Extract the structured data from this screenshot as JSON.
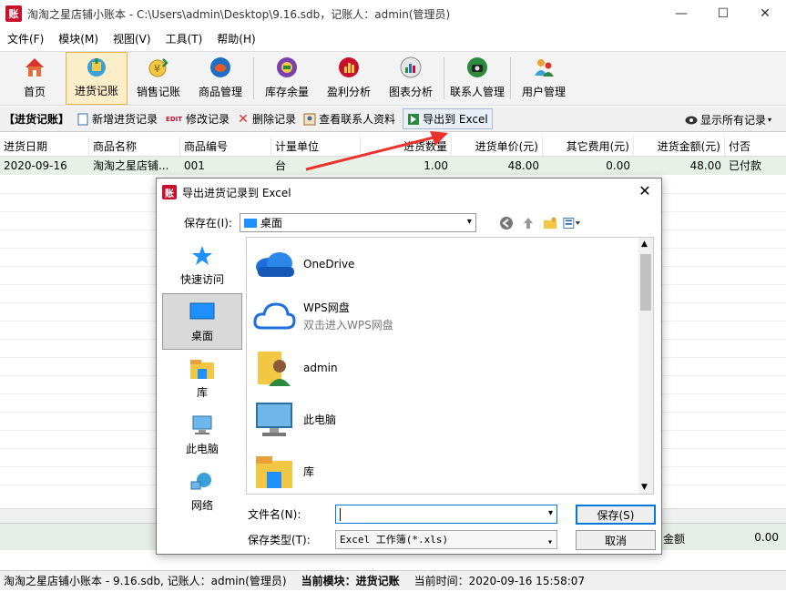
{
  "window": {
    "logo": "账",
    "title": "淘淘之星店铺小账本 - C:\\Users\\admin\\Desktop\\9.16.sdb，记账人：admin(管理员)",
    "minimize": "—",
    "maximize": "☐",
    "close": "✕"
  },
  "menu": [
    "文件(F)",
    "模块(M)",
    "视图(V)",
    "工具(T)",
    "帮助(H)"
  ],
  "toolbar": [
    {
      "label": "首页",
      "icon": "home-icon"
    },
    {
      "label": "进货记账",
      "icon": "purchase-icon",
      "active": true
    },
    {
      "label": "销售记账",
      "icon": "sales-icon"
    },
    {
      "label": "商品管理",
      "icon": "product-icon"
    },
    {
      "label": "库存余量",
      "icon": "inventory-icon"
    },
    {
      "label": "盈利分析",
      "icon": "profit-icon"
    },
    {
      "label": "图表分析",
      "icon": "chart-icon"
    },
    {
      "label": "联系人管理",
      "icon": "contact-icon"
    },
    {
      "label": "用户管理",
      "icon": "user-icon"
    }
  ],
  "subbar": {
    "title": "【进货记账】",
    "new": "新增进货记录",
    "edit_tag": "EDIT",
    "edit": "修改记录",
    "delete": "删除记录",
    "view_contact": "查看联系人资料",
    "export": "导出到 Excel",
    "show_all": "显示所有记录"
  },
  "grid": {
    "columns": [
      "进货日期",
      "商品名称",
      "商品编号",
      "计量单位",
      "进货数量",
      "进货单价(元)",
      "其它费用(元)",
      "进货金额(元)",
      "付否"
    ],
    "rows": [
      [
        "2020-09-16",
        "淘淘之星店铺...",
        "001",
        "台",
        "1.00",
        "48.00",
        "0.00",
        "48.00",
        "已付款"
      ]
    ]
  },
  "summary": {
    "label": "金额",
    "value": "0.00"
  },
  "status": {
    "app": "淘淘之星店铺小账本 - 9.16.sdb, 记账人：admin(管理员)",
    "module_label": "当前模块：",
    "module": "进货记账",
    "time_label": "当前时间：",
    "time": "2020-09-16 15:58:07"
  },
  "dialog": {
    "logo": "账",
    "title": "导出进货记录到 Excel",
    "save_in_label": "保存在(I):",
    "save_in_value": "桌面",
    "places": [
      {
        "label": "快速访问",
        "icon": "star-icon"
      },
      {
        "label": "桌面",
        "icon": "desktop-icon",
        "active": true
      },
      {
        "label": "库",
        "icon": "library-icon"
      },
      {
        "label": "此电脑",
        "icon": "computer-icon"
      },
      {
        "label": "网络",
        "icon": "network-icon"
      }
    ],
    "files": [
      {
        "name": "OneDrive",
        "sub": "",
        "icon": "onedrive-icon"
      },
      {
        "name": "WPS网盘",
        "sub": "双击进入WPS网盘",
        "icon": "wps-cloud-icon"
      },
      {
        "name": "admin",
        "sub": "",
        "icon": "user-folder-icon"
      },
      {
        "name": "此电脑",
        "sub": "",
        "icon": "computer-icon"
      },
      {
        "name": "库",
        "sub": "",
        "icon": "library-icon"
      }
    ],
    "filename_label": "文件名(N):",
    "filename_value": "",
    "filetype_label": "保存类型(T):",
    "filetype_value": "Excel 工作簿(*.xls)",
    "save_button": "保存(S)",
    "cancel_button": "取消"
  },
  "colors": {
    "accent": "#0078d7",
    "arrow": "#e8322a",
    "active_toolbar": "#fbeec8",
    "row_highlight": "#e8f1e8"
  }
}
